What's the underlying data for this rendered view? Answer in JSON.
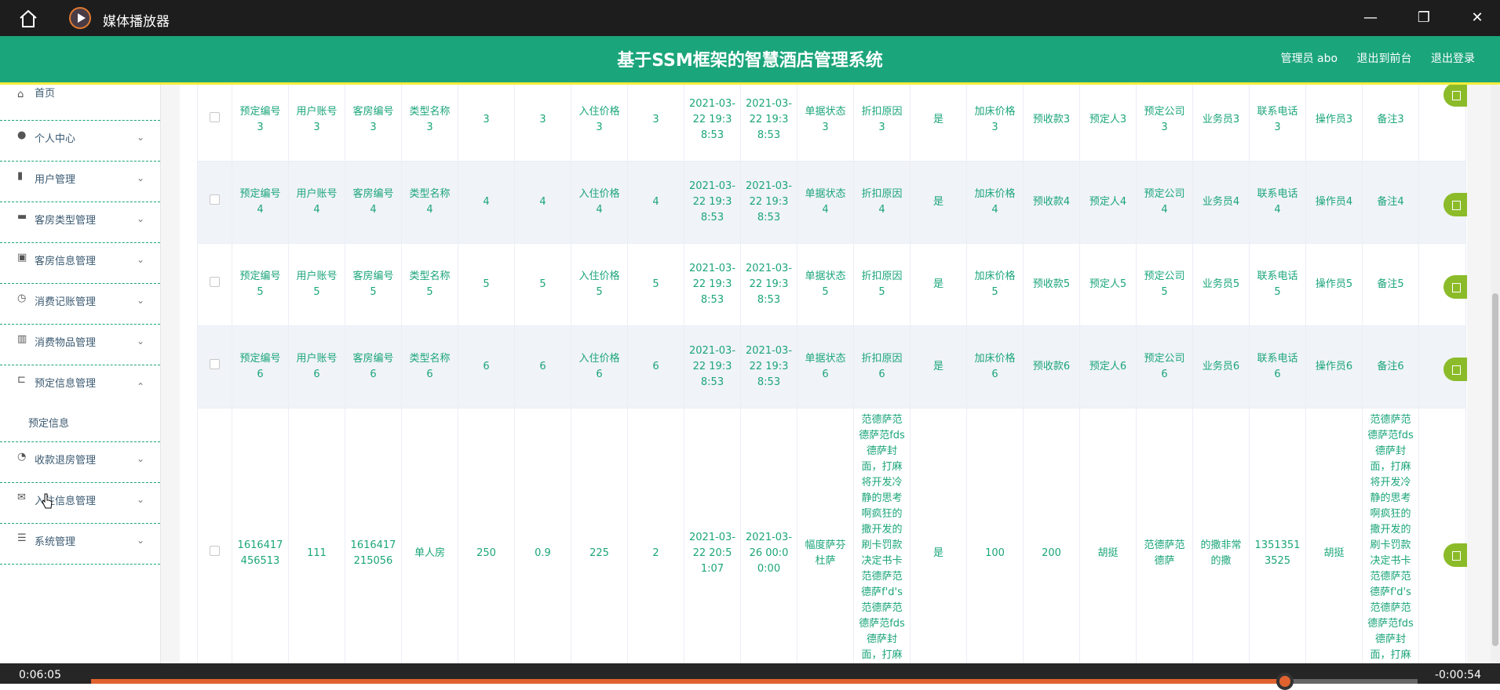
{
  "titlebar": {
    "title": "媒体播放器"
  },
  "header": {
    "title": "基于SSM框架的智慧酒店管理系统",
    "links": [
      "管理员 abo",
      "退出到前台",
      "退出登录"
    ]
  },
  "sidebar": {
    "items": [
      {
        "label": "首页",
        "icon": "home-icon",
        "glyph": "⌂",
        "expandable": false
      },
      {
        "label": "个人中心",
        "icon": "user-icon",
        "glyph": "●",
        "expandable": true
      },
      {
        "label": "用户管理",
        "icon": "book-icon",
        "glyph": "▮",
        "expandable": true
      },
      {
        "label": "客房类型管理",
        "icon": "bed-icon",
        "glyph": "▬",
        "expandable": true
      },
      {
        "label": "客房信息管理",
        "icon": "clipboard-icon",
        "glyph": "▣",
        "expandable": true
      },
      {
        "label": "消费记账管理",
        "icon": "gauge-icon",
        "glyph": "◷",
        "expandable": true
      },
      {
        "label": "消费物品管理",
        "icon": "bar-chart-icon",
        "glyph": "▥",
        "expandable": true
      },
      {
        "label": "预定信息管理",
        "icon": "crop-icon",
        "glyph": "⊏",
        "expandable": true,
        "expanded": true,
        "children": [
          "预定信息"
        ]
      },
      {
        "label": "收款退房管理",
        "icon": "clock-icon",
        "glyph": "◔",
        "expandable": true
      },
      {
        "label": "入住信息管理",
        "icon": "mail-icon",
        "glyph": "✉",
        "expandable": true
      },
      {
        "label": "系统管理",
        "icon": "sliders-icon",
        "glyph": "☰",
        "expandable": true
      }
    ]
  },
  "table": {
    "rows": [
      {
        "cells": [
          "预定编号3",
          "用户账号3",
          "客房编号3",
          "类型名称3",
          "3",
          "3",
          "入住价格3",
          "3",
          "2021-03-22 19:38:53",
          "2021-03-22 19:38:53",
          "单据状态3",
          "折扣原因3",
          "是",
          "加床价格3",
          "预收款3",
          "预定人3",
          "预定公司3",
          "业务员3",
          "联系电话3",
          "操作员3",
          "备注3"
        ]
      },
      {
        "cells": [
          "预定编号4",
          "用户账号4",
          "客房编号4",
          "类型名称4",
          "4",
          "4",
          "入住价格4",
          "4",
          "2021-03-22 19:38:53",
          "2021-03-22 19:38:53",
          "单据状态4",
          "折扣原因4",
          "是",
          "加床价格4",
          "预收款4",
          "预定人4",
          "预定公司4",
          "业务员4",
          "联系电话4",
          "操作员4",
          "备注4"
        ]
      },
      {
        "cells": [
          "预定编号5",
          "用户账号5",
          "客房编号5",
          "类型名称5",
          "5",
          "5",
          "入住价格5",
          "5",
          "2021-03-22 19:38:53",
          "2021-03-22 19:38:53",
          "单据状态5",
          "折扣原因5",
          "是",
          "加床价格5",
          "预收款5",
          "预定人5",
          "预定公司5",
          "业务员5",
          "联系电话5",
          "操作员5",
          "备注5"
        ]
      },
      {
        "cells": [
          "预定编号6",
          "用户账号6",
          "客房编号6",
          "类型名称6",
          "6",
          "6",
          "入住价格6",
          "6",
          "2021-03-22 19:38:53",
          "2021-03-22 19:38:53",
          "单据状态6",
          "折扣原因6",
          "是",
          "加床价格6",
          "预收款6",
          "预定人6",
          "预定公司6",
          "业务员6",
          "联系电话6",
          "操作员6",
          "备注6"
        ]
      },
      {
        "cells": [
          "1616417456513",
          "111",
          "1616417215056",
          "单人房",
          "250",
          "0.9",
          "225",
          "2",
          "2021-03-22 20:51:07",
          "2021-03-26 00:00:00",
          "幅度萨芬杜萨",
          "范德萨范德萨范fds德萨封面，打麻将开发冷静的思考啊疯狂的撒开发的刷卡罚款决定书卡范德萨范德萨f'd's范德萨范德萨范fds德萨封面，打麻将开发冷静的思考",
          "是",
          "100",
          "200",
          "胡挺",
          "范德萨范德萨",
          "的撒非常的撒",
          "13513513525",
          "胡挺",
          "范德萨范德萨范fds德萨封面，打麻将开发冷静的思考啊疯狂的撒开发的刷卡罚款决定书卡范德萨范德萨f'd's范德萨范德萨范fds德萨封面，打麻将开发冷静的思考"
        ]
      }
    ]
  },
  "player": {
    "elapsed": "0:06:05",
    "remaining": "-0:00:54",
    "progress": 0.9
  }
}
